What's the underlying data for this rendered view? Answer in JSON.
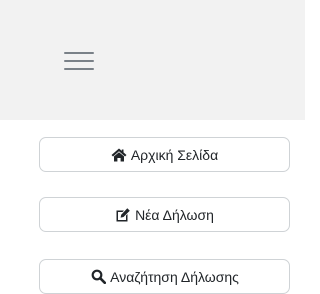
{
  "header": {
    "menu_toggle_icon": "hamburger-icon"
  },
  "menu": {
    "items": [
      {
        "label": "Αρχική Σελίδα",
        "icon": "home-icon"
      },
      {
        "label": "Νέα Δήλωση",
        "icon": "edit-icon"
      },
      {
        "label": "Αναζήτηση Δήλωσης",
        "icon": "search-icon"
      }
    ]
  }
}
